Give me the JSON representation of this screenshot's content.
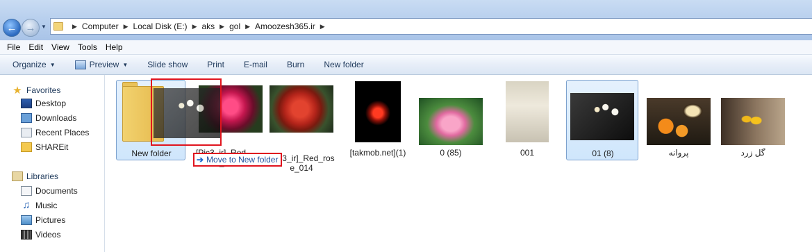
{
  "address": {
    "crumbs": [
      "Computer",
      "Local Disk (E:)",
      "aks",
      "gol",
      "Amoozesh365.ir"
    ]
  },
  "menu": [
    "File",
    "Edit",
    "View",
    "Tools",
    "Help"
  ],
  "toolbar": {
    "organize": "Organize",
    "preview": "Preview",
    "slideshow": "Slide show",
    "print": "Print",
    "email": "E-mail",
    "burn": "Burn",
    "new_folder": "New folder"
  },
  "sidebar": {
    "favorites": "Favorites",
    "desktop": "Desktop",
    "downloads": "Downloads",
    "recent": "Recent Places",
    "shareit": "SHAREit",
    "libraries": "Libraries",
    "documents": "Documents",
    "music": "Music",
    "pictures": "Pictures",
    "videos": "Videos"
  },
  "files": {
    "folder": "New folder",
    "pinkrose_partial_top": "[Pic3_ir]_Red",
    "pinkrose_partial_bottom": "_",
    "redrose_line1": "[Pic3_ir]_Red_ros",
    "redrose_line2": "e_014",
    "takmob": "[takmob.net](1)",
    "lotus": "0 (85)",
    "vase": "001",
    "daisy": "01 (8)",
    "butterfly": "پروانه",
    "tulip": "گل زرد"
  },
  "drag": {
    "tooltip": "Move to New folder"
  },
  "colors": {
    "highlight_border": "#e0141e",
    "selection_bg": "#cfe6fc"
  }
}
